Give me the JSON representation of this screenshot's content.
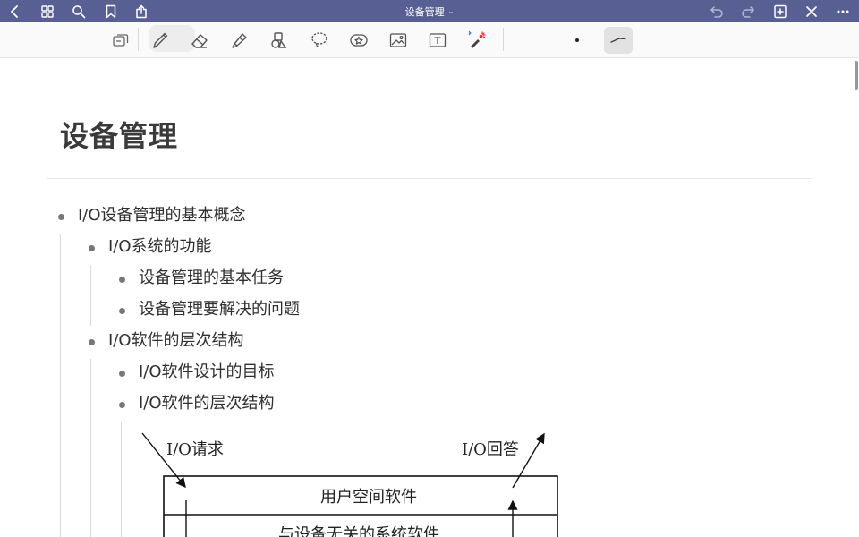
{
  "app": {
    "title": "设备管理"
  },
  "topbar": {
    "left_icons": [
      "back-icon",
      "grid-icon",
      "search-icon",
      "bookmark-icon",
      "share-icon"
    ],
    "right_icons": [
      "undo-icon",
      "redo-icon",
      "add-page-icon",
      "close-icon",
      "more-icon"
    ]
  },
  "toolbar": {
    "tools": [
      "page-toggle-icon",
      "pen-icon",
      "eraser-icon",
      "highlighter-icon",
      "shapes-icon",
      "lasso-icon",
      "sticker-icon",
      "image-icon",
      "text-icon",
      "laser-pointer-icon"
    ],
    "pen_size": "dot",
    "active_stroke": "stroke-style-icon"
  },
  "document": {
    "heading": "设备管理",
    "outline": [
      {
        "level": 1,
        "text": "I/O设备管理的基本概念"
      },
      {
        "level": 2,
        "text": "I/O系统的功能"
      },
      {
        "level": 3,
        "text": "设备管理的基本任务"
      },
      {
        "level": 3,
        "text": "设备管理要解决的问题"
      },
      {
        "level": 2,
        "text": "I/O软件的层次结构"
      },
      {
        "level": 3,
        "text": "I/O软件设计的目标"
      },
      {
        "level": 3,
        "text": "I/O软件的层次结构"
      }
    ],
    "figure": {
      "request_label": "I/O请求",
      "reply_label": "I/O回答",
      "layers": [
        "用户空间软件",
        "与设备无关的系统软件"
      ]
    }
  }
}
